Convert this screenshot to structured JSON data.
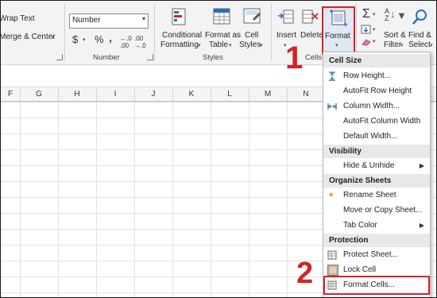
{
  "ribbon": {
    "alignment": {
      "wrap_text": "Wrap Text",
      "merge_center": "Merge & Center"
    },
    "number": {
      "format_value": "Number",
      "currency_symbol": "$",
      "percent_symbol": "%",
      "comma_symbol": "‚",
      "group_label": "Number"
    },
    "styles": {
      "conditional_1": "Conditional",
      "conditional_2": "Formatting",
      "format_table_1": "Format as",
      "format_table_2": "Table",
      "cell_styles_1": "Cell",
      "cell_styles_2": "Styles",
      "group_label": "Styles"
    },
    "cells": {
      "insert": "Insert",
      "delete": "Delete",
      "format": "Format",
      "group_label": "Cells"
    },
    "editing": {
      "sort_filter_1": "Sort &",
      "sort_filter_2": "Filter",
      "find_select_1": "Find &",
      "find_select_2": "Select"
    }
  },
  "columns": [
    "F",
    "G",
    "H",
    "I",
    "J",
    "K",
    "L",
    "M",
    "N"
  ],
  "menu": {
    "sections": {
      "cell_size": "Cell Size",
      "visibility": "Visibility",
      "organize": "Organize Sheets",
      "protection": "Protection"
    },
    "items": {
      "row_height": "Row Height...",
      "autofit_row": "AutoFit Row Height",
      "column_width": "Column Width...",
      "autofit_column": "AutoFit Column Width",
      "default_width": "Default Width...",
      "hide_unhide": "Hide & Unhide",
      "rename_sheet": "Rename Sheet",
      "move_copy": "Move or Copy Sheet...",
      "tab_color": "Tab Color",
      "protect_sheet": "Protect Sheet...",
      "lock_cell": "Lock Cell",
      "format_cells": "Format Cells..."
    }
  },
  "annotations": {
    "step1": "1",
    "step2": "2"
  },
  "colors": {
    "highlight": "#d62222",
    "accent_blue": "#2a6ebb",
    "rename_orange": "#e8962b"
  }
}
